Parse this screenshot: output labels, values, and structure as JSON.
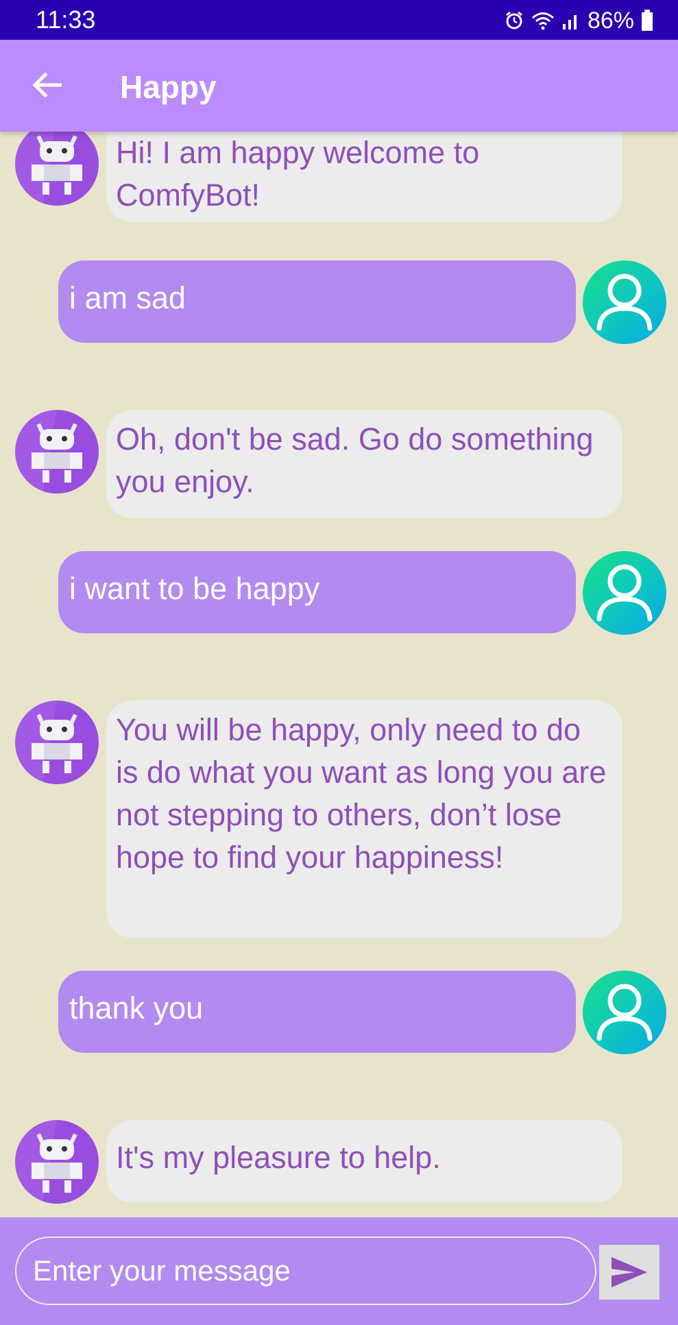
{
  "status_bar": {
    "time": "11:33",
    "battery": "86%"
  },
  "app_bar": {
    "title": "Happy",
    "back_icon": "arrow-left-icon"
  },
  "messages": [
    {
      "sender": "bot",
      "text": "Hi! I am happy welcome to ComfyBot!"
    },
    {
      "sender": "user",
      "text": "i am sad"
    },
    {
      "sender": "bot",
      "text": "Oh, don't be sad. Go do something you enjoy."
    },
    {
      "sender": "user",
      "text": "i want to be happy"
    },
    {
      "sender": "bot",
      "text": "You will be happy, only need to do is do what you want as long you are not stepping to others, don’t lose hope to find your happiness!"
    },
    {
      "sender": "user",
      "text": "thank you"
    },
    {
      "sender": "bot",
      "text": "It's my pleasure to help."
    }
  ],
  "composer": {
    "placeholder": "Enter your message",
    "send_icon": "send-icon"
  },
  "colors": {
    "status_bar": "#2a00b0",
    "app_bar": "#bc8bfd",
    "background": "#e8e4cb",
    "bot_bubble": "#ececec",
    "bot_text": "#8e4fb8",
    "user_bubble": "#b28af0",
    "user_text": "#ffffff"
  }
}
